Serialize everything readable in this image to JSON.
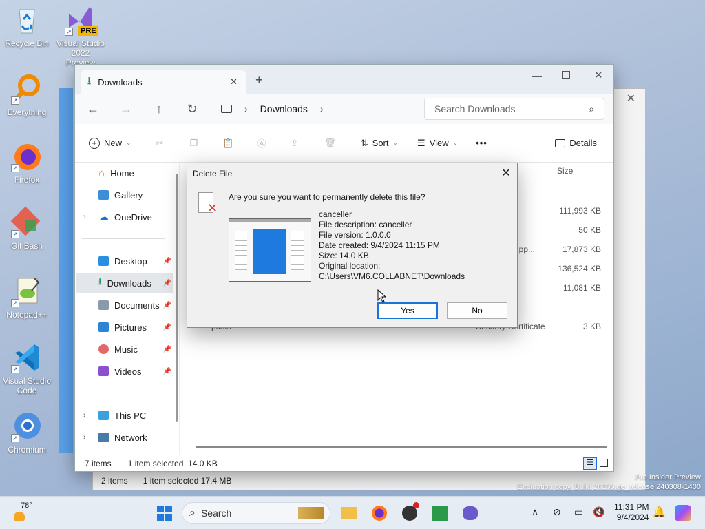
{
  "desktop": {
    "icons": [
      {
        "label": "Recycle Bin",
        "icon": "recycle-bin-icon"
      },
      {
        "label": "Visual Studio 2022 Preview",
        "icon": "visual-studio-preview-icon",
        "badge": "PRE"
      },
      {
        "label": "Everything",
        "icon": "everything-search-icon"
      },
      {
        "label": "Firefox",
        "icon": "firefox-icon"
      },
      {
        "label": "Git Bash",
        "icon": "git-bash-icon"
      },
      {
        "label": "Notepad++",
        "icon": "notepad-plus-plus-icon"
      },
      {
        "label": "Visual Studio Code",
        "icon": "vscode-icon"
      },
      {
        "label": "Chromium",
        "icon": "chromium-icon"
      }
    ],
    "watermark_line1": "Pro Insider Preview",
    "watermark_line2": "Evaluation copy. Build 26100.ge_release 240308-1400"
  },
  "back_window": {
    "status_items": "2 items",
    "status_selected": "1 item selected 17.4 MB"
  },
  "explorer": {
    "tab_label": "Downloads",
    "address": "Downloads",
    "search_placeholder": "Search Downloads",
    "commands": {
      "new": "New",
      "sort": "Sort",
      "view": "View",
      "more": "•••",
      "details": "Details"
    },
    "nav": {
      "home": "Home",
      "gallery": "Gallery",
      "onedrive": "OneDrive",
      "desktop": "Desktop",
      "downloads": "Downloads",
      "documents": "Documents",
      "pictures": "Pictures",
      "music": "Music",
      "videos": "Videos",
      "this_pc": "This PC",
      "network": "Network"
    },
    "columns": {
      "size": "Size"
    },
    "files": [
      {
        "type": "",
        "size": "111,993 KB"
      },
      {
        "type": "",
        "size": "50 KB"
      },
      {
        "type": "d (zipp...",
        "size": "17,873 KB"
      },
      {
        "type": "",
        "size": "136,524 KB"
      },
      {
        "type": "",
        "size": "11,081 KB"
      },
      {
        "name": "pcnts",
        "type": "Security Certificate",
        "size": "3 KB"
      }
    ],
    "status_items": "7 items",
    "status_selected": "1 item selected",
    "status_size": "14.0 KB"
  },
  "dialog": {
    "title": "Delete File",
    "message": "Are you sure you want to permanently delete this file?",
    "file_name": "canceller",
    "file_description": "File description: canceller",
    "file_version": "File version: 1.0.0.0",
    "date_created": "Date created: 9/4/2024 11:15 PM",
    "size": "Size: 14.0 KB",
    "original_location_label": "Original location:",
    "original_location": "C:\\Users\\VM6.COLLABNET\\Downloads",
    "yes": "Yes",
    "no": "No"
  },
  "taskbar": {
    "weather_temp": "78°",
    "search_label": "Search",
    "time": "11:31 PM",
    "date": "9/4/2024"
  }
}
